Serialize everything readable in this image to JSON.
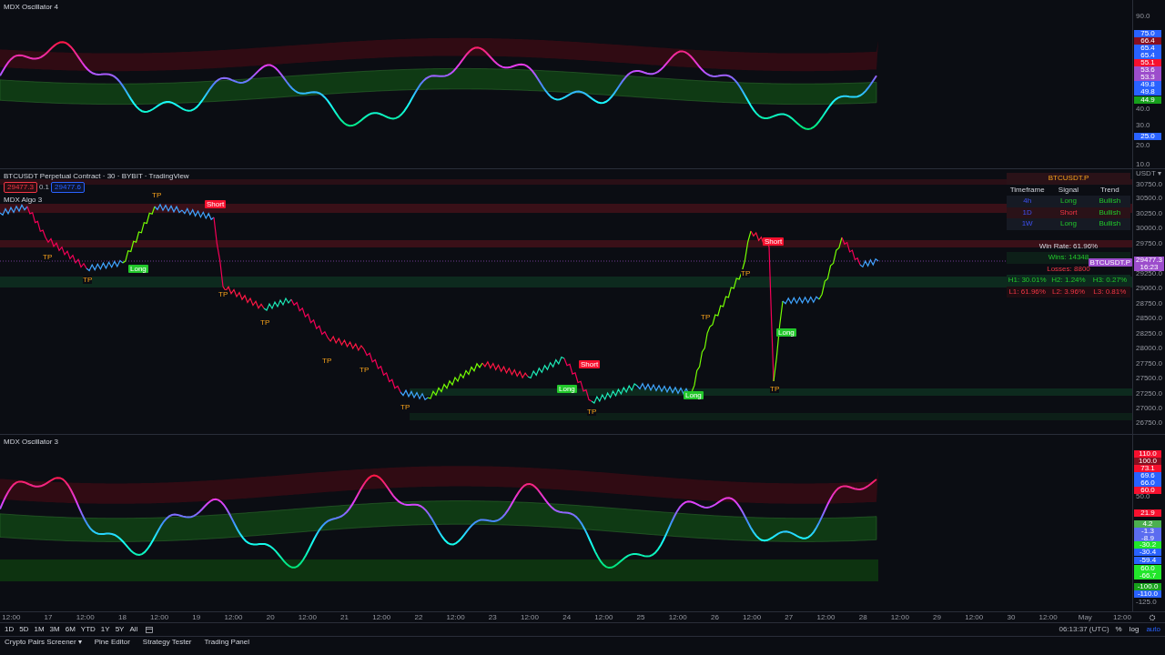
{
  "oscillator_top": {
    "title": "MDX Oscillator 4",
    "axis": [
      {
        "text": "90.0",
        "kind": "tick"
      },
      {
        "text": "75.0",
        "kind": "badge",
        "color": "#2962ff"
      },
      {
        "text": "66.4",
        "kind": "badge",
        "color": "#880e1f"
      },
      {
        "text": "65.4",
        "kind": "badge",
        "color": "#2962ff"
      },
      {
        "text": "65.4",
        "kind": "badge",
        "color": "#2962ff"
      },
      {
        "text": "55.1",
        "kind": "badge",
        "color": "#f7102e"
      },
      {
        "text": "53.6",
        "kind": "badge",
        "color": "#9c4dcc"
      },
      {
        "text": "53.3",
        "kind": "badge",
        "color": "#9c4dcc"
      },
      {
        "text": "49.8",
        "kind": "badge",
        "color": "#2962ff"
      },
      {
        "text": "49.8",
        "kind": "badge",
        "color": "#2962ff"
      },
      {
        "text": "44.9",
        "kind": "badge",
        "color": "#17a01c"
      },
      {
        "text": "40.0",
        "kind": "tick"
      },
      {
        "text": "30.0",
        "kind": "tick"
      },
      {
        "text": "25.0",
        "kind": "badge",
        "color": "#2962ff"
      },
      {
        "text": "20.0",
        "kind": "tick"
      },
      {
        "text": "10.0",
        "kind": "tick"
      }
    ]
  },
  "main_chart": {
    "title": "BTCUSDT Perpetual Contract · 30 · BYBIT · TradingView",
    "bid": "29477.3",
    "spread": "0.1",
    "ask": "29477.6",
    "indicator": "MDX Algo 3",
    "signals": [
      {
        "kind": "short",
        "text": "Short"
      },
      {
        "kind": "short",
        "text": "Short"
      },
      {
        "kind": "short",
        "text": "Short"
      },
      {
        "kind": "long",
        "text": "Long"
      },
      {
        "kind": "long",
        "text": "Long"
      },
      {
        "kind": "long",
        "text": "Long"
      },
      {
        "kind": "long",
        "text": "Long"
      }
    ],
    "take_profits": [
      "TP",
      "TP",
      "TP",
      "TP",
      "TP",
      "TP",
      "TP",
      "TP",
      "TP",
      "TP",
      "TP",
      "TP"
    ],
    "currency": "USDT ▾",
    "axis": [
      "30750.0",
      "30500.0",
      "30250.0",
      "30000.0",
      "29750.0",
      "29250.0",
      "29000.0",
      "28750.0",
      "28500.0",
      "28250.0",
      "28000.0",
      "27750.0",
      "27500.0",
      "27250.0",
      "27000.0",
      "26750.0"
    ],
    "last_price": {
      "symbol": "BTCUSDT.P",
      "price": "29477.3",
      "countdown": "16:23"
    },
    "panel": {
      "symbol": "BTCUSDT.P",
      "columns": [
        "Timeframe",
        "Signal",
        "Trend"
      ],
      "rows": [
        {
          "timeframe": "4h",
          "signal": {
            "text": "Long",
            "kind": "long"
          },
          "trend": {
            "text": "Bullish",
            "kind": "bullish"
          }
        },
        {
          "timeframe": "1D",
          "signal": {
            "text": "Short",
            "kind": "short"
          },
          "trend": {
            "text": "Bullish",
            "kind": "bullish"
          }
        },
        {
          "timeframe": "1W",
          "signal": {
            "text": "Long",
            "kind": "long"
          },
          "trend": {
            "text": "Bullish",
            "kind": "bullish"
          }
        }
      ],
      "win_rate": "Win Rate: 61.96%",
      "wins": "Wins: 14348",
      "losses": "Losses: 8800",
      "highs": [
        "H1: 30.01%",
        "H2: 1.24%",
        "H3: 0.27%"
      ],
      "lows": [
        "L1: 61.96%",
        "L2: 3.96%",
        "L3: 0.81%"
      ]
    }
  },
  "oscillator_bottom": {
    "title": "MDX Oscillator 3",
    "axis": [
      {
        "text": "110.0",
        "kind": "badge",
        "color": "#f7102e"
      },
      {
        "text": "100.0",
        "kind": "badge",
        "color": "#880e1f"
      },
      {
        "text": "73.1",
        "kind": "badge",
        "color": "#f7102e"
      },
      {
        "text": "69.6",
        "kind": "badge",
        "color": "#2962ff"
      },
      {
        "text": "66.0",
        "kind": "badge",
        "color": "#2962ff"
      },
      {
        "text": "60.0",
        "kind": "badge",
        "color": "#f7102e"
      },
      {
        "text": "50.0",
        "kind": "tick"
      },
      {
        "text": "21.9",
        "kind": "badge",
        "color": "#f7102e"
      },
      {
        "text": "4.2",
        "kind": "badge",
        "color": "#4caf50"
      },
      {
        "text": "-1.3",
        "kind": "badge",
        "color": "#5b6cf0"
      },
      {
        "text": "-8.9",
        "kind": "badge",
        "color": "#5b6cf0"
      },
      {
        "text": "-30.2",
        "kind": "badge",
        "color": "#22e62b"
      },
      {
        "text": "-30.4",
        "kind": "badge",
        "color": "#2962ff"
      },
      {
        "text": "-59.4",
        "kind": "badge",
        "color": "#2962ff"
      },
      {
        "text": "60.0",
        "kind": "badge",
        "color": "#22e62b"
      },
      {
        "text": "-66.7",
        "kind": "badge",
        "color": "#22e62b"
      },
      {
        "text": "-100.0",
        "kind": "badge",
        "color": "#17a01c"
      },
      {
        "text": "-110.0",
        "kind": "badge",
        "color": "#2962ff"
      },
      {
        "text": "-125.0",
        "kind": "tick"
      }
    ]
  },
  "time_axis": [
    "12:00",
    "17",
    "12:00",
    "18",
    "12:00",
    "19",
    "12:00",
    "20",
    "12:00",
    "21",
    "12:00",
    "22",
    "12:00",
    "23",
    "12:00",
    "24",
    "12:00",
    "25",
    "12:00",
    "26",
    "12:00",
    "27",
    "12:00",
    "28",
    "12:00",
    "29",
    "12:00",
    "30",
    "12:00",
    "May",
    "12:00"
  ],
  "ranges": [
    "1D",
    "5D",
    "1M",
    "3M",
    "6M",
    "YTD",
    "1Y",
    "5Y",
    "All"
  ],
  "clock": "06:13:37 (UTC)",
  "scale_options": [
    {
      "label": "%",
      "selected": false
    },
    {
      "label": "log",
      "selected": false
    },
    {
      "label": "auto",
      "selected": true
    }
  ],
  "bottom_tabs": [
    {
      "label": "Crypto Pairs Screener",
      "caret": "▾"
    },
    {
      "label": "Pine Editor"
    },
    {
      "label": "Strategy Tester"
    },
    {
      "label": "Trading Panel"
    }
  ]
}
